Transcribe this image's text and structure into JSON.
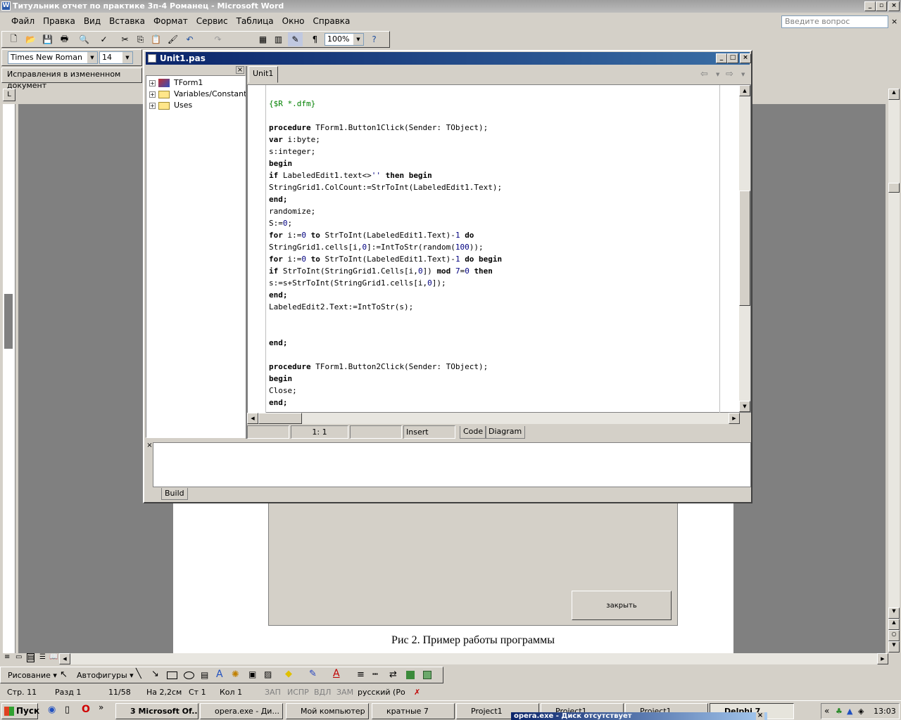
{
  "word": {
    "title": "Титульник отчет по практике 3п-4 Романец - Microsoft Word",
    "menu": [
      "Файл",
      "Правка",
      "Вид",
      "Вставка",
      "Формат",
      "Сервис",
      "Таблица",
      "Окно",
      "Справка"
    ],
    "ask_placeholder": "Введите вопрос",
    "zoom": "100%",
    "font_name": "Times New Roman",
    "font_size": "14",
    "revisions_label": "Исправления в измененном документ",
    "embedded_button": "закрыть",
    "caption": "Рис 2. Пример работы программы",
    "draw_label": "Рисование",
    "autoshapes_label": "Автофигуры",
    "status": {
      "page": "Стр. 11",
      "section": "Разд 1",
      "pages": "11/58",
      "at": "На 2,2см",
      "line": "Ст 1",
      "col": "Кол 1",
      "rec": "ЗАП",
      "trk": "ИСПР",
      "ext": "ВДЛ",
      "ovr": "ЗАМ",
      "lang": "русский (Ро"
    }
  },
  "delphi": {
    "title": "Unit1.pas",
    "tab": "Unit1",
    "tree": [
      "TForm1",
      "Variables/Constants",
      "Uses"
    ],
    "code_lines": [
      [
        {
          "t": "{$R *.dfm}",
          "c": "cmt"
        }
      ],
      [],
      [
        {
          "t": "procedure",
          "c": "kw"
        },
        {
          "t": " TForm1.Button1Click(Sender: TObject);"
        }
      ],
      [
        {
          "t": "var",
          "c": "kw"
        },
        {
          "t": " i:byte;"
        }
      ],
      [
        {
          "t": "s:integer;"
        }
      ],
      [
        {
          "t": "begin",
          "c": "kw"
        }
      ],
      [
        {
          "t": "if",
          "c": "kw"
        },
        {
          "t": " LabeledEdit1.text<>"
        },
        {
          "t": "''",
          "c": "str"
        },
        {
          "t": " "
        },
        {
          "t": "then begin",
          "c": "kw"
        }
      ],
      [
        {
          "t": "StringGrid1.ColCount:=StrToInt(LabeledEdit1.Text);"
        }
      ],
      [
        {
          "t": "end;",
          "c": "kw"
        }
      ],
      [
        {
          "t": "randomize;"
        }
      ],
      [
        {
          "t": "S:="
        },
        {
          "t": "0",
          "c": "num"
        },
        {
          "t": ";"
        }
      ],
      [
        {
          "t": "for",
          "c": "kw"
        },
        {
          "t": " i:="
        },
        {
          "t": "0",
          "c": "num"
        },
        {
          "t": " "
        },
        {
          "t": "to",
          "c": "kw"
        },
        {
          "t": " StrToInt(LabeledEdit1.Text)-"
        },
        {
          "t": "1",
          "c": "num"
        },
        {
          "t": " "
        },
        {
          "t": "do",
          "c": "kw"
        }
      ],
      [
        {
          "t": "StringGrid1.cells[i,"
        },
        {
          "t": "0",
          "c": "num"
        },
        {
          "t": "]:=IntToStr(random("
        },
        {
          "t": "100",
          "c": "num"
        },
        {
          "t": "));"
        }
      ],
      [
        {
          "t": "for",
          "c": "kw"
        },
        {
          "t": " i:="
        },
        {
          "t": "0",
          "c": "num"
        },
        {
          "t": " "
        },
        {
          "t": "to",
          "c": "kw"
        },
        {
          "t": " StrToInt(LabeledEdit1.Text)-"
        },
        {
          "t": "1",
          "c": "num"
        },
        {
          "t": " "
        },
        {
          "t": "do begin",
          "c": "kw"
        }
      ],
      [
        {
          "t": "if",
          "c": "kw"
        },
        {
          "t": " StrToInt(StringGrid1.Cells[i,"
        },
        {
          "t": "0",
          "c": "num"
        },
        {
          "t": "]) "
        },
        {
          "t": "mod",
          "c": "kw"
        },
        {
          "t": " "
        },
        {
          "t": "7",
          "c": "num"
        },
        {
          "t": "="
        },
        {
          "t": "0",
          "c": "num"
        },
        {
          "t": " "
        },
        {
          "t": "then",
          "c": "kw"
        }
      ],
      [
        {
          "t": "s:=s+StrToInt(StringGrid1.cells[i,"
        },
        {
          "t": "0",
          "c": "num"
        },
        {
          "t": "]);"
        }
      ],
      [
        {
          "t": "end;",
          "c": "kw"
        }
      ],
      [
        {
          "t": "LabeledEdit2.Text:=IntToStr(s);"
        }
      ],
      [],
      [],
      [
        {
          "t": "end;",
          "c": "kw"
        }
      ],
      [],
      [
        {
          "t": "procedure",
          "c": "kw"
        },
        {
          "t": " TForm1.Button2Click(Sender: TObject);"
        }
      ],
      [
        {
          "t": "begin",
          "c": "kw"
        }
      ],
      [
        {
          "t": "Close;"
        }
      ],
      [
        {
          "t": "end;",
          "c": "kw"
        }
      ]
    ],
    "cursor_pos": "1:  1",
    "mode": "Insert",
    "view_tabs": [
      "Code",
      "Diagram"
    ],
    "build_tab": "Build"
  },
  "taskbar": {
    "start": "Пуск",
    "items": [
      "3 Microsoft Of...",
      "opera.exe - Ди...",
      "Мой компьютер",
      "кратные 7",
      "Project1",
      "Project1",
      "Project1",
      "Delphi 7"
    ],
    "clock": "13:03",
    "notice": "opera.exe - Диск отсутствует"
  }
}
